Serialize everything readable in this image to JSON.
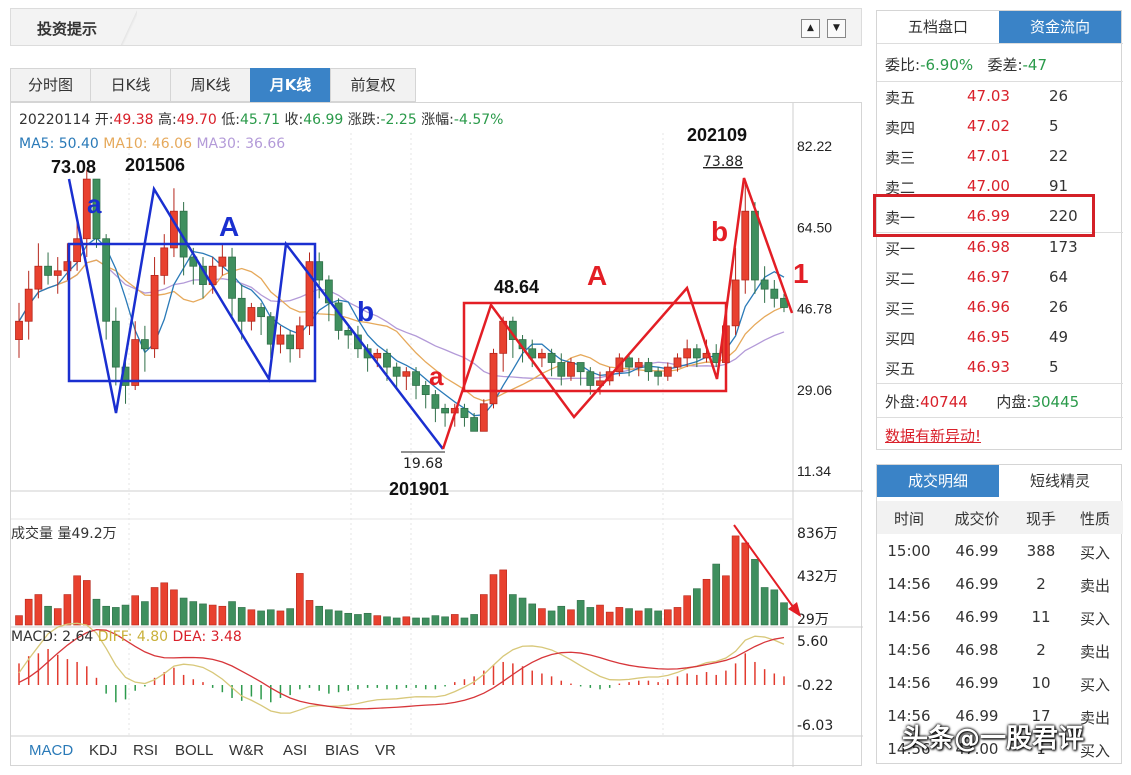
{
  "header": {
    "title": "投资提示",
    "up_icon": "triangle-up-icon",
    "down_icon": "triangle-down-icon"
  },
  "chart_tabs": [
    "分时图",
    "日K线",
    "周K线",
    "月K线",
    "前复权"
  ],
  "active_tab": 3,
  "ohlc_info": {
    "date": "20220114",
    "open_label": "开:",
    "open": "49.38",
    "high_label": "高:",
    "high": "49.70",
    "low_label": "低:",
    "low": "45.71",
    "close_label": "收:",
    "close": "46.99",
    "chg_label": "涨跌:",
    "chg": "-2.25",
    "pct_label": "涨幅:",
    "pct": "-4.57%"
  },
  "ma_info": {
    "ma5": "MA5: 50.40",
    "ma10": "MA10: 46.06",
    "ma30": "MA30: 36.66"
  },
  "price_axis": [
    "82.22",
    "64.50",
    "46.78",
    "29.06",
    "11.34"
  ],
  "volume_title": "成交量 量49.2万",
  "volume_axis": [
    "836万",
    "432万",
    "29万"
  ],
  "macd_info": {
    "macd": "MACD: 2.64",
    "diff": "DIFF: 4.80",
    "dea": "DEA: 3.48"
  },
  "macd_axis": [
    "5.60",
    "-0.22",
    "-6.03"
  ],
  "indicator_tabs": [
    "MACD",
    "KDJ",
    "RSI",
    "BOLL",
    "W&R",
    "ASI",
    "BIAS",
    "VR"
  ],
  "annotations": {
    "high1_price": "73.08",
    "high1_date": "201506",
    "low_price": "19.68",
    "low_date": "201901",
    "mid_price": "48.64",
    "high2_date": "202109",
    "high2_price": "73.88",
    "wave_a1": "a",
    "wave_A1": "A",
    "wave_b1": "b",
    "wave_a2": "a",
    "wave_A2": "A",
    "wave_b2": "b",
    "wave_1": "1"
  },
  "colors": {
    "up": "#e8412f",
    "down": "#3f8f5e",
    "blue_draw": "#1a2fd0",
    "red_draw": "#e31e25",
    "ma5": "#2a7ab8",
    "ma10": "#e6a95b",
    "ma30": "#b39ad8"
  },
  "chart_data": {
    "type": "candlestick",
    "period": "monthly",
    "ylim": [
      11.34,
      82.22
    ],
    "candles": [
      [
        40,
        44,
        36,
        48
      ],
      [
        44,
        51,
        40,
        55
      ],
      [
        51,
        56,
        49,
        61
      ],
      [
        56,
        54,
        52,
        59
      ],
      [
        54,
        55,
        50,
        58
      ],
      [
        55,
        57,
        53,
        61
      ],
      [
        57,
        62,
        55,
        66
      ],
      [
        62,
        75,
        58,
        77
      ],
      [
        75,
        62,
        60,
        75
      ],
      [
        62,
        44,
        40,
        63
      ],
      [
        44,
        34,
        30,
        47
      ],
      [
        34,
        30,
        26,
        36
      ],
      [
        30,
        40,
        29,
        44
      ],
      [
        40,
        38,
        33,
        43
      ],
      [
        38,
        54,
        36,
        58
      ],
      [
        54,
        60,
        52,
        63
      ],
      [
        60,
        68,
        58,
        73
      ],
      [
        68,
        58,
        54,
        70
      ],
      [
        58,
        56,
        52,
        60
      ],
      [
        56,
        52,
        49,
        58
      ],
      [
        52,
        56,
        50,
        58
      ],
      [
        56,
        58,
        54,
        61
      ],
      [
        58,
        49,
        45,
        60
      ],
      [
        49,
        44,
        40,
        52
      ],
      [
        44,
        47,
        42,
        48
      ],
      [
        47,
        45,
        41,
        48
      ],
      [
        45,
        39,
        36,
        46
      ],
      [
        39,
        41,
        37,
        43
      ],
      [
        41,
        38,
        35,
        42
      ],
      [
        38,
        43,
        36,
        45
      ],
      [
        43,
        57,
        41,
        59
      ],
      [
        57,
        53,
        49,
        59
      ],
      [
        53,
        48,
        44,
        54
      ],
      [
        48,
        42,
        40,
        49
      ],
      [
        42,
        41,
        38,
        43
      ],
      [
        41,
        38,
        36,
        43
      ],
      [
        38,
        36,
        33,
        39
      ],
      [
        36,
        37,
        34,
        38
      ],
      [
        37,
        34,
        31,
        38
      ],
      [
        34,
        32,
        29,
        35
      ],
      [
        32,
        33,
        29,
        34
      ],
      [
        33,
        30,
        27,
        34
      ],
      [
        30,
        28,
        25,
        31
      ],
      [
        28,
        25,
        22,
        29
      ],
      [
        25,
        24,
        21,
        26
      ],
      [
        24,
        25,
        21,
        26
      ],
      [
        25,
        23,
        21,
        26
      ],
      [
        23,
        20,
        20,
        24
      ],
      [
        20,
        26,
        20,
        27
      ],
      [
        26,
        37,
        25,
        38
      ],
      [
        37,
        44,
        33,
        45
      ],
      [
        44,
        40,
        36,
        45
      ],
      [
        40,
        38,
        35,
        41
      ],
      [
        38,
        36,
        34,
        40
      ],
      [
        36,
        37,
        34,
        38
      ],
      [
        37,
        35,
        32,
        38
      ],
      [
        35,
        32,
        30,
        37
      ],
      [
        32,
        35,
        31,
        36
      ],
      [
        35,
        33,
        30,
        35
      ],
      [
        33,
        30,
        28,
        34
      ],
      [
        30,
        31,
        28,
        33
      ],
      [
        31,
        33,
        30,
        34
      ],
      [
        33,
        36,
        32,
        37
      ],
      [
        36,
        34,
        32,
        37
      ],
      [
        34,
        35,
        32,
        36
      ],
      [
        35,
        33,
        31,
        36
      ],
      [
        33,
        32,
        30,
        34
      ],
      [
        32,
        34,
        31,
        35
      ],
      [
        34,
        36,
        33,
        37
      ],
      [
        36,
        38,
        34,
        40
      ],
      [
        38,
        36,
        34,
        39
      ],
      [
        36,
        37,
        35,
        40
      ],
      [
        37,
        35,
        34,
        39
      ],
      [
        35,
        43,
        34,
        48
      ],
      [
        43,
        53,
        41,
        60
      ],
      [
        53,
        68,
        50,
        74
      ],
      [
        68,
        53,
        50,
        70
      ],
      [
        53,
        51,
        48,
        56
      ],
      [
        51,
        49,
        47,
        53
      ],
      [
        49,
        47,
        46,
        50
      ]
    ],
    "volume": [
      80,
      220,
      260,
      160,
      140,
      260,
      420,
      380,
      220,
      160,
      150,
      170,
      250,
      200,
      320,
      360,
      300,
      230,
      200,
      180,
      170,
      160,
      200,
      150,
      130,
      120,
      130,
      120,
      140,
      440,
      210,
      160,
      130,
      120,
      100,
      90,
      100,
      80,
      70,
      60,
      70,
      60,
      60,
      80,
      70,
      90,
      60,
      90,
      260,
      430,
      470,
      260,
      230,
      180,
      140,
      120,
      160,
      130,
      210,
      150,
      170,
      110,
      150,
      140,
      120,
      140,
      120,
      130,
      150,
      250,
      310,
      390,
      520,
      420,
      760,
      700,
      560,
      320,
      300,
      190
    ],
    "macd_hist": [
      1.5,
      2.0,
      2.2,
      2.5,
      2.1,
      1.8,
      1.6,
      1.3,
      0.5,
      -0.6,
      -1.2,
      -1.0,
      -0.4,
      -0.1,
      0.5,
      0.9,
      1.2,
      0.7,
      0.4,
      0.2,
      -0.2,
      -0.5,
      -0.9,
      -1.1,
      -0.8,
      -1.0,
      -1.2,
      -0.9,
      -0.7,
      -0.3,
      -0.2,
      -0.4,
      -0.6,
      -0.5,
      -0.4,
      -0.3,
      -0.2,
      -0.2,
      -0.3,
      -0.3,
      -0.2,
      -0.2,
      -0.3,
      -0.3,
      -0.1,
      0.2,
      0.4,
      0.6,
      1.0,
      1.4,
      1.6,
      1.5,
      1.3,
      1.0,
      0.8,
      0.6,
      0.3,
      0.1,
      -0.1,
      -0.2,
      -0.3,
      -0.2,
      0.1,
      0.2,
      0.3,
      0.3,
      0.2,
      0.4,
      0.6,
      0.8,
      0.7,
      0.9,
      0.7,
      1.0,
      1.5,
      2.2,
      1.6,
      1.1,
      0.8,
      0.6
    ],
    "series": [
      {
        "name": "MA5",
        "color": "#2a7ab8"
      },
      {
        "name": "MA10",
        "color": "#e6a95b"
      },
      {
        "name": "MA30",
        "color": "#b39ad8"
      }
    ]
  },
  "quote_panel": {
    "tabs": [
      "五档盘口",
      "资金流向"
    ],
    "wb_label": "委比:",
    "wb": "-6.90%",
    "wc_label": "委差:",
    "wc": "-47",
    "sells": [
      [
        "卖五",
        "47.03",
        "26"
      ],
      [
        "卖四",
        "47.02",
        "5"
      ],
      [
        "卖三",
        "47.01",
        "22"
      ],
      [
        "卖二",
        "47.00",
        "91"
      ],
      [
        "卖一",
        "46.99",
        "220"
      ]
    ],
    "buys": [
      [
        "买一",
        "46.98",
        "173"
      ],
      [
        "买二",
        "46.97",
        "64"
      ],
      [
        "买三",
        "46.96",
        "26"
      ],
      [
        "买四",
        "46.95",
        "49"
      ],
      [
        "买五",
        "46.93",
        "5"
      ]
    ],
    "outer_label": "外盘:",
    "outer": "40744",
    "inner_label": "内盘:",
    "inner": "30445",
    "alert_link": "数据有新异动!"
  },
  "trade_panel": {
    "tabs": [
      "成交明细",
      "短线精灵"
    ],
    "headers": [
      "时间",
      "成交价",
      "现手",
      "性质"
    ],
    "rows": [
      [
        "15:00",
        "46.99",
        "388",
        "买入"
      ],
      [
        "14:56",
        "46.99",
        "2",
        "卖出"
      ],
      [
        "14:56",
        "46.99",
        "11",
        "买入"
      ],
      [
        "14:56",
        "46.98",
        "2",
        "卖出"
      ],
      [
        "14:56",
        "46.99",
        "10",
        "买入"
      ],
      [
        "14:56",
        "46.99",
        "17",
        "卖出"
      ],
      [
        "14:56",
        "47.00",
        "1",
        "买入"
      ]
    ]
  },
  "watermark": "头条@一股君评"
}
